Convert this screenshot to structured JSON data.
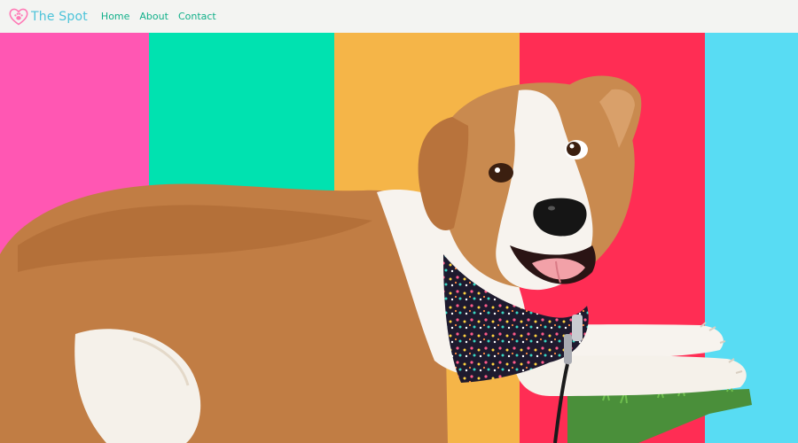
{
  "app": {
    "brand_name": "The Spot",
    "logo_icon": "heart-paw-icon"
  },
  "nav": {
    "items": [
      {
        "label": "Home"
      },
      {
        "label": "About"
      },
      {
        "label": "Contact"
      }
    ]
  },
  "hero": {
    "image": "dog-with-paw-print-bandana",
    "stripe_colors": [
      "#ff57b3",
      "#00e2b0",
      "#f5b548",
      "#ff2d54",
      "#58dcf3"
    ]
  },
  "colors": {
    "brand": "#4cc3d9",
    "logo_heart": "#ff7ab6",
    "nav_link": "#12b08a",
    "navbar_bg": "#f3f4f2"
  }
}
